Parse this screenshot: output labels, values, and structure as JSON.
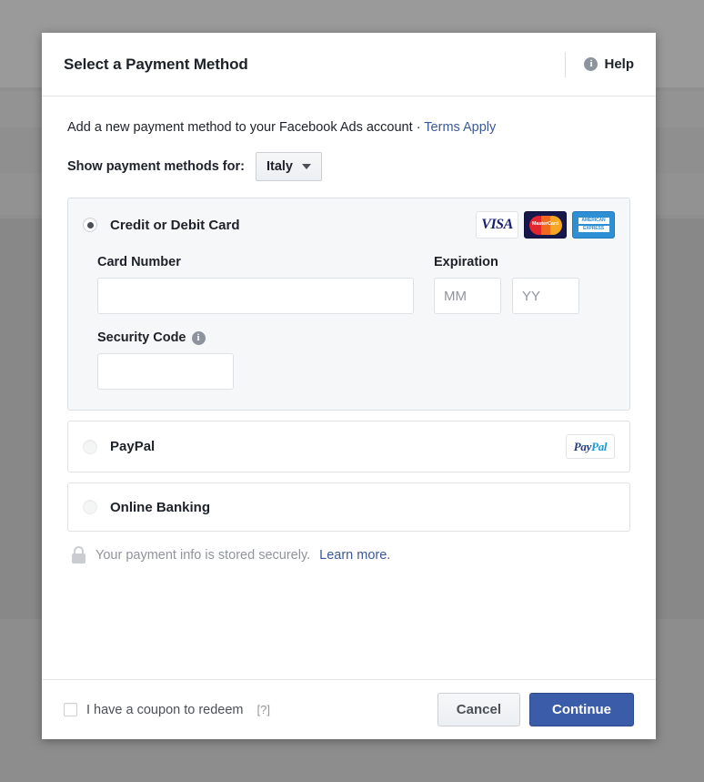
{
  "header": {
    "title": "Select a Payment Method",
    "help_label": "Help",
    "info_glyph": "i"
  },
  "body": {
    "intro_text": "Add a new payment method to your Facebook Ads account ",
    "intro_separator": "· ",
    "intro_link": "Terms Apply",
    "country_label": "Show payment methods for:",
    "country_value": "Italy"
  },
  "options": [
    {
      "id": "credit-debit-card",
      "label": "Credit or Debit Card",
      "selected": true,
      "logos": [
        "visa",
        "mastercard",
        "amex"
      ]
    },
    {
      "id": "paypal",
      "label": "PayPal",
      "selected": false,
      "logos": [
        "paypal"
      ]
    },
    {
      "id": "online-banking",
      "label": "Online Banking",
      "selected": false,
      "logos": []
    }
  ],
  "card_form": {
    "card_number_label": "Card Number",
    "card_number_value": "",
    "card_number_placeholder": "",
    "expiration_label": "Expiration",
    "month_placeholder": "MM",
    "month_value": "",
    "year_placeholder": "YY",
    "year_value": "",
    "security_code_label": "Security Code",
    "security_code_value": "",
    "security_code_placeholder": ""
  },
  "brands": {
    "visa_text": "VISA",
    "mastercard_text": "MasterCard",
    "amex_line1": "AMERICAN",
    "amex_line2": "EXPRESS",
    "paypal_pay": "Pay",
    "paypal_pal": "Pal"
  },
  "secure": {
    "text": "Your payment info is stored securely.",
    "link": "Learn more."
  },
  "footer": {
    "coupon_label": "I have a coupon to redeem",
    "coupon_hint": "[?]",
    "coupon_checked": false,
    "cancel_label": "Cancel",
    "continue_label": "Continue"
  },
  "colors": {
    "primary_button": "#3b5ca8",
    "link": "#3b5998",
    "text": "#1d2129",
    "muted": "#90949c",
    "panel": "#f6f7f9",
    "visa_blue": "#1a1f71",
    "mastercard_navy": "#16174a",
    "amex_blue": "#2e8fd4"
  }
}
